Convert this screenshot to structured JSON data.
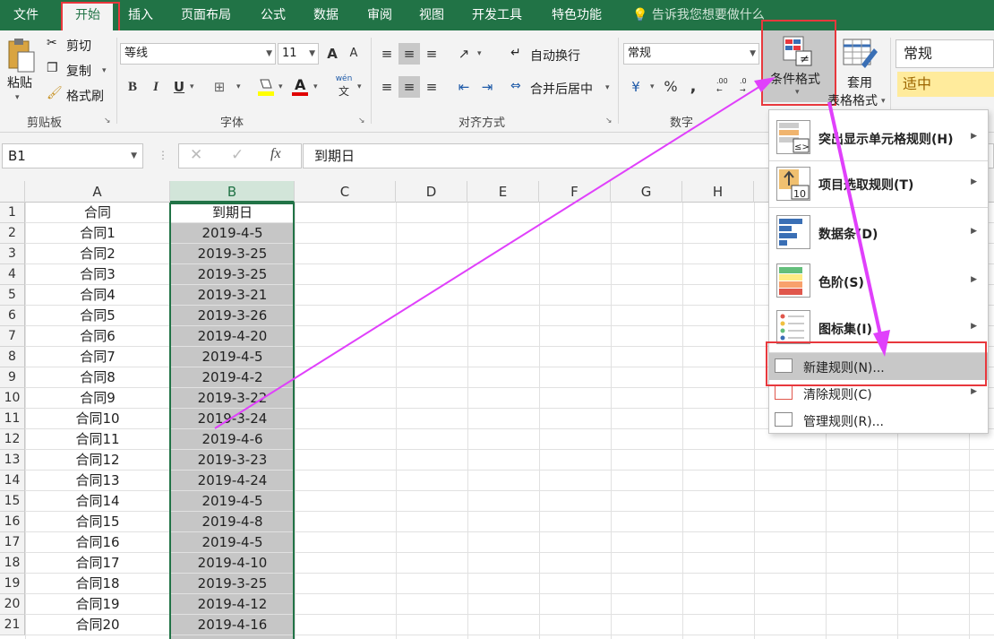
{
  "tabs": [
    "文件",
    "开始",
    "插入",
    "页面布局",
    "公式",
    "数据",
    "审阅",
    "视图",
    "开发工具",
    "特色功能"
  ],
  "tell_me": "告诉我您想要做什么",
  "clipboard": {
    "paste": "粘贴",
    "cut": "剪切",
    "copy": "复制",
    "format_painter": "格式刷",
    "group": "剪贴板"
  },
  "font": {
    "name": "等线",
    "size": "11",
    "bold": "B",
    "italic": "I",
    "underline": "U",
    "phonetic": "wén",
    "phonetic_char": "文",
    "group": "字体",
    "grow": "A",
    "shrink": "A",
    "font_color_glyph": "A"
  },
  "alignment": {
    "wrap": "自动换行",
    "merge": "合并后居中",
    "group": "对齐方式"
  },
  "number": {
    "format": "常规",
    "percent": "%",
    "comma": ",",
    "group": "数字",
    "inc_decimal": ".00",
    "dec_decimal": ".0"
  },
  "styles": {
    "conditional_format": "条件格式",
    "table_line1": "套用",
    "table_line2": "表格格式",
    "normal": "常规",
    "neutral": "适中"
  },
  "formula_bar": {
    "name_box": "B1",
    "formula": "到期日",
    "fx": "fx",
    "cancel": "✕",
    "enter": "✓"
  },
  "columns": [
    "A",
    "B",
    "C",
    "D",
    "E",
    "F",
    "G",
    "H"
  ],
  "rows": [
    [
      "合同",
      "到期日"
    ],
    [
      "合同1",
      "2019-4-5"
    ],
    [
      "合同2",
      "2019-3-25"
    ],
    [
      "合同3",
      "2019-3-25"
    ],
    [
      "合同4",
      "2019-3-21"
    ],
    [
      "合同5",
      "2019-3-26"
    ],
    [
      "合同6",
      "2019-4-20"
    ],
    [
      "合同7",
      "2019-4-5"
    ],
    [
      "合同8",
      "2019-4-2"
    ],
    [
      "合同9",
      "2019-3-22"
    ],
    [
      "合同10",
      "2019-3-24"
    ],
    [
      "合同11",
      "2019-4-6"
    ],
    [
      "合同12",
      "2019-3-23"
    ],
    [
      "合同13",
      "2019-4-24"
    ],
    [
      "合同14",
      "2019-4-5"
    ],
    [
      "合同15",
      "2019-4-8"
    ],
    [
      "合同16",
      "2019-4-5"
    ],
    [
      "合同17",
      "2019-4-10"
    ],
    [
      "合同18",
      "2019-3-25"
    ],
    [
      "合同19",
      "2019-4-12"
    ],
    [
      "合同20",
      "2019-4-16"
    ]
  ],
  "menu": {
    "highlight": "突出显示单元格规则(H)",
    "topbottom": "项目选取规则(T)",
    "databar": "数据条(D)",
    "colorscale": "色阶(S)",
    "iconset": "图标集(I)",
    "new_rule": "新建规则(N)...",
    "clear_rule": "清除规则(C)",
    "manage_rule": "管理规则(R)...",
    "ne_icon_text": "≠",
    "lte_icon_text": "≤>",
    "ten_icon_text": "10"
  },
  "colors": {
    "accent": "#217346",
    "highlight_red": "#e8383d",
    "arrow": "#e040fb",
    "selection": "#c6c6c6"
  }
}
